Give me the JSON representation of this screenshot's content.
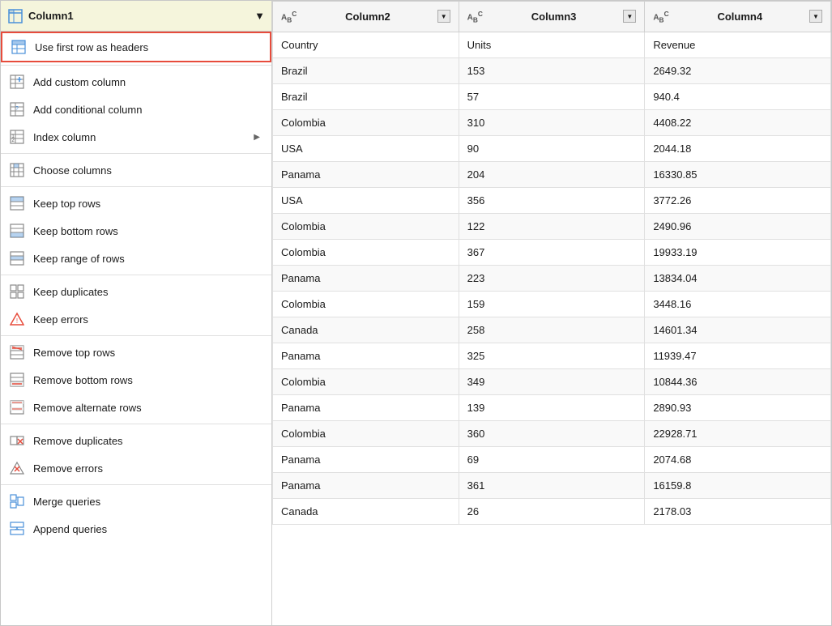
{
  "menu": {
    "header": {
      "column_label": "Column1",
      "dropdown_arrow": "▼"
    },
    "items": [
      {
        "id": "use-first-row",
        "label": "Use first row as headers",
        "icon": "use-first-row-icon",
        "highlighted": true,
        "has_arrow": false
      },
      {
        "id": "divider-1",
        "type": "divider"
      },
      {
        "id": "add-custom-column",
        "label": "Add custom column",
        "icon": "add-custom-column-icon",
        "highlighted": false,
        "has_arrow": false
      },
      {
        "id": "add-conditional-column",
        "label": "Add conditional column",
        "icon": "add-conditional-column-icon",
        "highlighted": false,
        "has_arrow": false
      },
      {
        "id": "index-column",
        "label": "Index column",
        "icon": "index-column-icon",
        "highlighted": false,
        "has_arrow": true
      },
      {
        "id": "divider-2",
        "type": "divider"
      },
      {
        "id": "choose-columns",
        "label": "Choose columns",
        "icon": "choose-columns-icon",
        "highlighted": false,
        "has_arrow": false
      },
      {
        "id": "divider-3",
        "type": "divider"
      },
      {
        "id": "keep-top-rows",
        "label": "Keep top rows",
        "icon": "keep-top-rows-icon",
        "highlighted": false,
        "has_arrow": false
      },
      {
        "id": "keep-bottom-rows",
        "label": "Keep bottom rows",
        "icon": "keep-bottom-rows-icon",
        "highlighted": false,
        "has_arrow": false
      },
      {
        "id": "keep-range-of-rows",
        "label": "Keep range of rows",
        "icon": "keep-range-rows-icon",
        "highlighted": false,
        "has_arrow": false
      },
      {
        "id": "divider-4",
        "type": "divider"
      },
      {
        "id": "keep-duplicates",
        "label": "Keep duplicates",
        "icon": "keep-duplicates-icon",
        "highlighted": false,
        "has_arrow": false
      },
      {
        "id": "keep-errors",
        "label": "Keep errors",
        "icon": "keep-errors-icon",
        "highlighted": false,
        "has_arrow": false
      },
      {
        "id": "divider-5",
        "type": "divider"
      },
      {
        "id": "remove-top-rows",
        "label": "Remove top rows",
        "icon": "remove-top-rows-icon",
        "highlighted": false,
        "has_arrow": false
      },
      {
        "id": "remove-bottom-rows",
        "label": "Remove bottom rows",
        "icon": "remove-bottom-rows-icon",
        "highlighted": false,
        "has_arrow": false
      },
      {
        "id": "remove-alternate-rows",
        "label": "Remove alternate rows",
        "icon": "remove-alternate-rows-icon",
        "highlighted": false,
        "has_arrow": false
      },
      {
        "id": "divider-6",
        "type": "divider"
      },
      {
        "id": "remove-duplicates",
        "label": "Remove duplicates",
        "icon": "remove-duplicates-icon",
        "highlighted": false,
        "has_arrow": false
      },
      {
        "id": "remove-errors",
        "label": "Remove errors",
        "icon": "remove-errors-icon",
        "highlighted": false,
        "has_arrow": false
      },
      {
        "id": "divider-7",
        "type": "divider"
      },
      {
        "id": "merge-queries",
        "label": "Merge queries",
        "icon": "merge-queries-icon",
        "highlighted": false,
        "has_arrow": false
      },
      {
        "id": "append-queries",
        "label": "Append queries",
        "icon": "append-queries-icon",
        "highlighted": false,
        "has_arrow": false
      }
    ]
  },
  "table": {
    "columns": [
      {
        "id": "col2",
        "label": "Column2",
        "type": "ABC"
      },
      {
        "id": "col3",
        "label": "Column3",
        "type": "ABC"
      },
      {
        "id": "col4",
        "label": "Column4",
        "type": "ABC"
      }
    ],
    "rows": [
      [
        "Country",
        "Units",
        "Revenue"
      ],
      [
        "Brazil",
        "153",
        "2649.32"
      ],
      [
        "Brazil",
        "57",
        "940.4"
      ],
      [
        "Colombia",
        "310",
        "4408.22"
      ],
      [
        "USA",
        "90",
        "2044.18"
      ],
      [
        "Panama",
        "204",
        "16330.85"
      ],
      [
        "USA",
        "356",
        "3772.26"
      ],
      [
        "Colombia",
        "122",
        "2490.96"
      ],
      [
        "Colombia",
        "367",
        "19933.19"
      ],
      [
        "Panama",
        "223",
        "13834.04"
      ],
      [
        "Colombia",
        "159",
        "3448.16"
      ],
      [
        "Canada",
        "258",
        "14601.34"
      ],
      [
        "Panama",
        "325",
        "11939.47"
      ],
      [
        "Colombia",
        "349",
        "10844.36"
      ],
      [
        "Panama",
        "139",
        "2890.93"
      ],
      [
        "Colombia",
        "360",
        "22928.71"
      ],
      [
        "Panama",
        "69",
        "2074.68"
      ],
      [
        "Panama",
        "361",
        "16159.8"
      ],
      [
        "Canada",
        "26",
        "2178.03"
      ]
    ]
  }
}
